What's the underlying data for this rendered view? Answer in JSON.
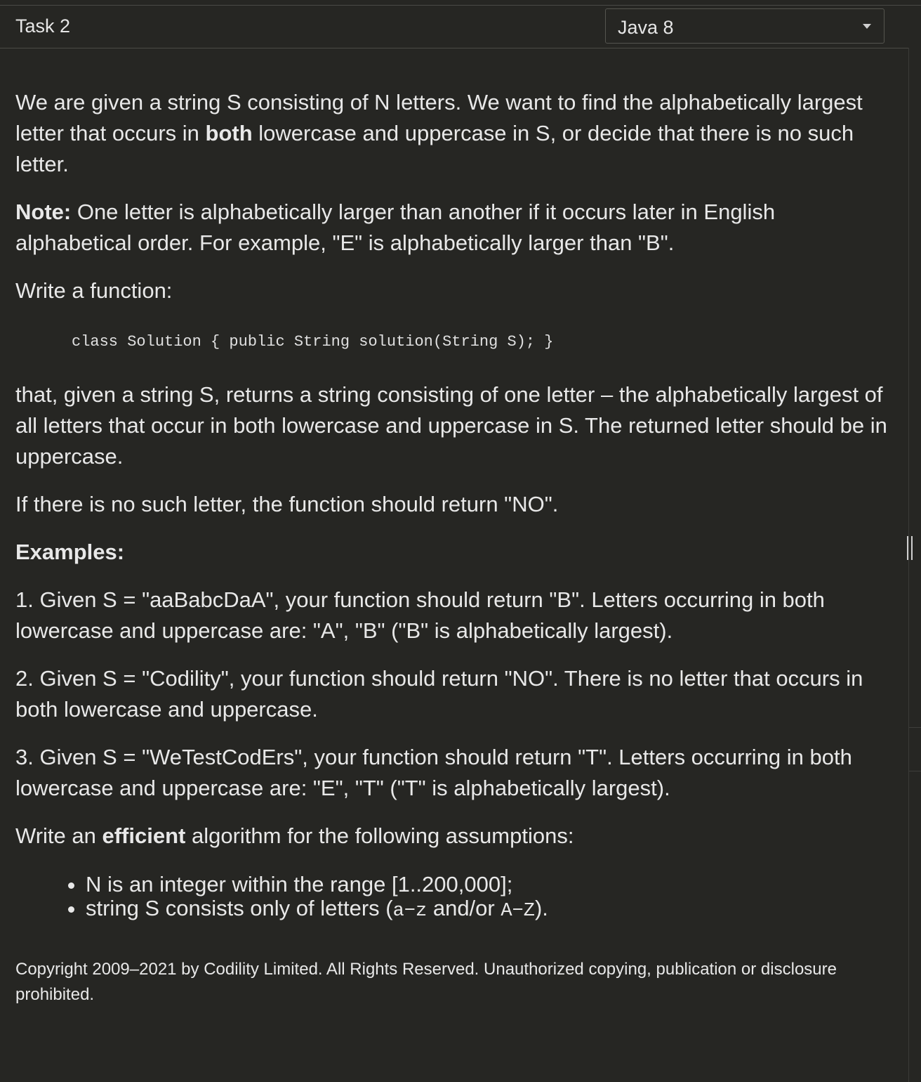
{
  "header": {
    "task_title": "Task 2",
    "language": "Java 8"
  },
  "description": {
    "p1_a": "We are given a string S consisting of N letters. We want to find the alphabetically largest letter that occurs in ",
    "p1_bold": "both",
    "p1_b": " lowercase and uppercase in S, or decide that there is no such letter.",
    "note_label": "Note:",
    "note_text": " One letter is alphabetically larger than another if it occurs later in English alphabetical order. For example, \"E\" is alphabetically larger than \"B\".",
    "write_function": "Write a function:",
    "code_signature": "class Solution { public String solution(String S); }",
    "p_returns": "that, given a string S, returns a string consisting of one letter – the alphabetically largest of all letters that occur in both lowercase and uppercase in S. The returned letter should be in uppercase.",
    "p_no_letter": "If there is no such letter, the function should return \"NO\".",
    "examples_label": "Examples:",
    "example_1": "1. Given S = \"aaBabcDaA\", your function should return \"B\". Letters occurring in both lowercase and uppercase are: \"A\", \"B\" (\"B\" is alphabetically largest).",
    "example_2": "2. Given S = \"Codility\", your function should return \"NO\". There is no letter that occurs in both lowercase and uppercase.",
    "example_3": "3. Given S = \"WeTestCodErs\", your function should return \"T\". Letters occurring in both lowercase and uppercase are: \"E\", \"T\" (\"T\" is alphabetically largest).",
    "efficient_a": "Write an ",
    "efficient_bold": "efficient",
    "efficient_b": " algorithm for the following assumptions:",
    "assumption_1": "N is an integer within the range [1..200,000];",
    "assumption_2_a": "string S consists only of letters (",
    "assumption_2_code1": "a−z",
    "assumption_2_mid": " and/or ",
    "assumption_2_code2": "A−Z",
    "assumption_2_b": ").",
    "copyright": "Copyright 2009–2021 by Codility Limited. All Rights Reserved. Unauthorized copying, publication or disclosure prohibited."
  }
}
